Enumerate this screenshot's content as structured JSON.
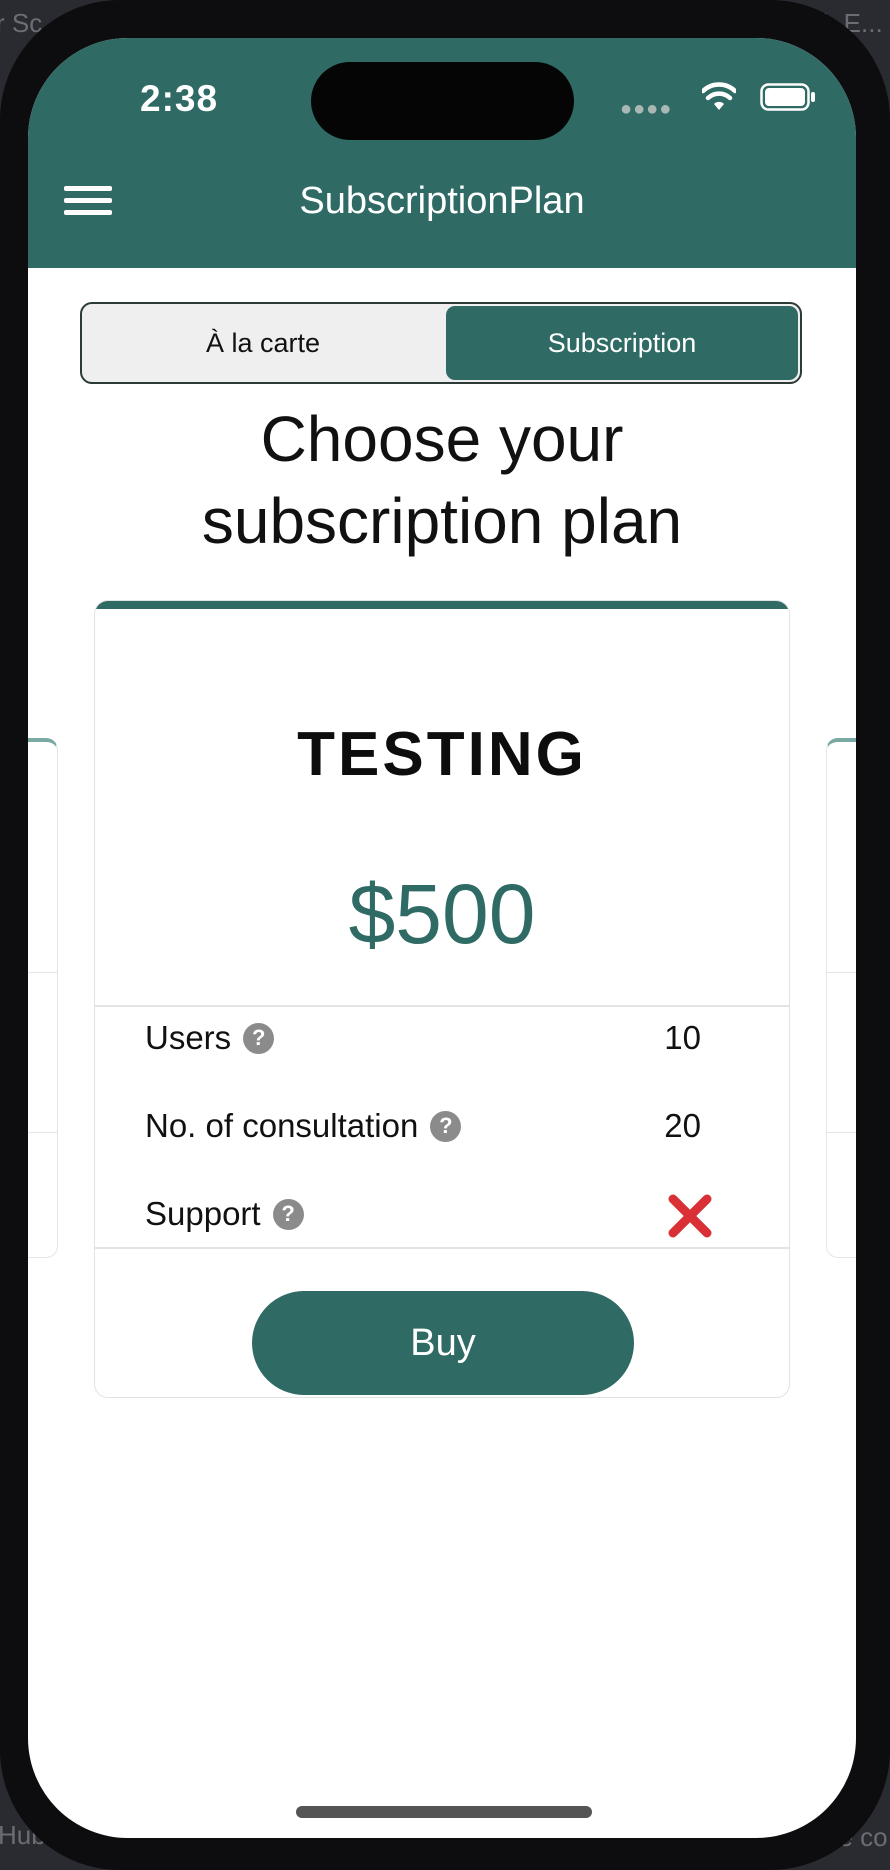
{
  "background": {
    "top_left": "r Sc",
    "top_right": "h E...",
    "bottom_left": "Hub/",
    "bottom_right": "ge co"
  },
  "status_bar": {
    "time": "2:38"
  },
  "nav": {
    "title": "SubscriptionPlan"
  },
  "segment": {
    "left_label": "À la carte",
    "right_label": "Subscription",
    "selected": "Subscription"
  },
  "heading": {
    "line1": "Choose your",
    "line2": "subscription plan"
  },
  "plan": {
    "name": "TESTING",
    "price": "$500",
    "features": [
      {
        "label": "Users",
        "value": "10"
      },
      {
        "label": "No. of consultation",
        "value": "20"
      },
      {
        "label": "Support",
        "value": "",
        "icon": "x-icon"
      }
    ],
    "buy_label": "Buy"
  },
  "colors": {
    "primary": "#2f6b64",
    "cross": "#d93036"
  }
}
